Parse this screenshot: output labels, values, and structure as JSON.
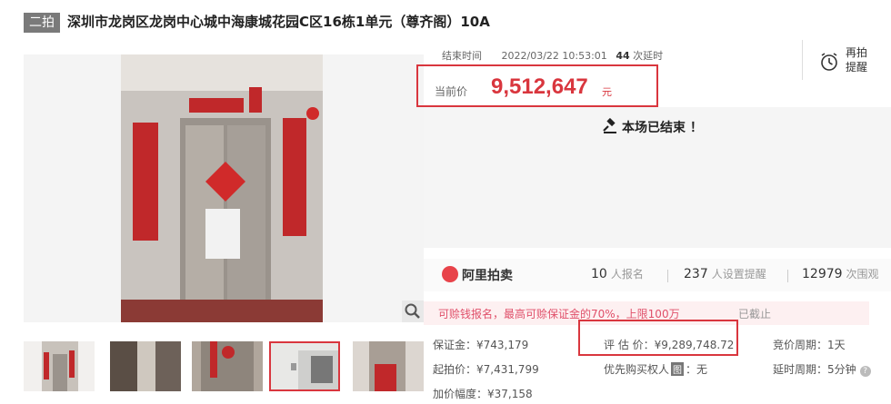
{
  "header": {
    "badge": "二拍",
    "title": "深圳市龙岗区龙岗中心城中海康城花园C区16栋1单元（尊齐阁）10A"
  },
  "auction": {
    "end_label": "结束时间",
    "end_time": "2022/03/22 10:53:01",
    "delay_count": "44",
    "delay_label": "次延时",
    "price_label": "当前价",
    "price_value": "9,512,647",
    "price_unit": "元",
    "remind_label": "再拍提醒",
    "ended_text": "本场已结束 ！"
  },
  "stats": {
    "brand": "阿里拍卖",
    "signups": "10",
    "signups_unit": "人报名",
    "reminders": "237",
    "reminders_unit": "人设置提醒",
    "views": "12979",
    "views_unit": "次围观"
  },
  "notice": {
    "text": "可赊钱报名，最高可赊保证金的70%，上限100万",
    "cutoff": "已截止"
  },
  "details": {
    "deposit": "保证金：¥743,179",
    "appraisal": "评 估 价：¥9,289,748.72",
    "cycle": "竞价周期：1天",
    "start_price": "起拍价：¥7,431,799",
    "priority_label": "优先购买权人",
    "priority_tag": "图",
    "priority_value": "：无",
    "delay_cycle": "延时周期：5分钟",
    "increment": "加价幅度：¥37,158"
  },
  "icons": {
    "zoom": "search-icon",
    "remind": "alarm-clock-icon",
    "ended": "gavel-icon",
    "brand": "alibaba-auction-logo",
    "help": "question-icon"
  },
  "colors": {
    "accent": "#d9363e",
    "notice": "#e0506a"
  }
}
